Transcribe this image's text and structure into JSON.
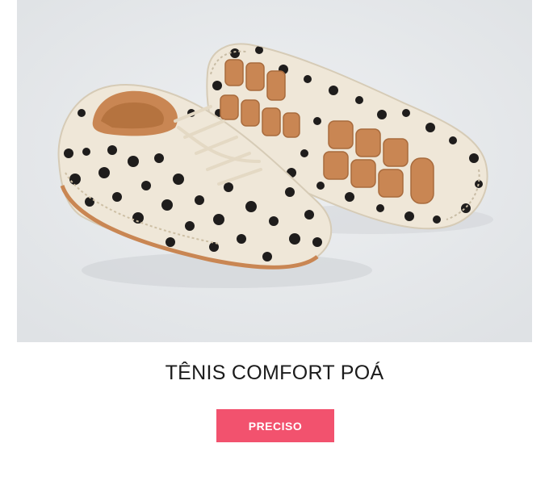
{
  "product": {
    "title": "TÊNIS COMFORT POÁ",
    "image": {
      "description_icon": "polka-dot-sneakers-photo"
    }
  },
  "cta": {
    "label": "PRECISO"
  },
  "colors": {
    "cta_background": "#f2526e",
    "cta_text": "#ffffff",
    "title_text": "#1b1b1b",
    "photo_background": "#e8eaec",
    "shoe_body": "#efe7d8",
    "shoe_dots": "#1f1d1c",
    "sole": "#c98653"
  }
}
